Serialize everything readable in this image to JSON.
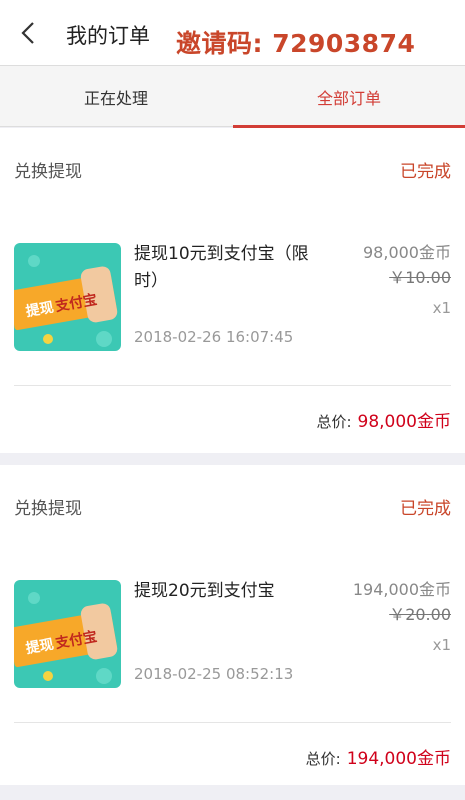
{
  "header": {
    "title": "我的订单",
    "invite": "邀请码: 72903874"
  },
  "tabs": [
    {
      "label": "正在处理"
    },
    {
      "label": "全部订单"
    }
  ],
  "orders": [
    {
      "type": "兑换提现",
      "status": "已完成",
      "thumb_text_a": "提现",
      "thumb_text_b": "支付宝",
      "name": "提现10元到支付宝（限时）",
      "date": "2018-02-26 16:07:45",
      "price": "98,000金币",
      "original": "￥10.00",
      "qty": "x1",
      "total_label": "总价:",
      "total": "98,000金币"
    },
    {
      "type": "兑换提现",
      "status": "已完成",
      "thumb_text_a": "提现",
      "thumb_text_b": "支付宝",
      "name": "提现20元到支付宝",
      "date": "2018-02-25 08:52:13",
      "price": "194,000金币",
      "original": "￥20.00",
      "qty": "x1",
      "total_label": "总价:",
      "total": "194,000金币"
    }
  ],
  "colors": {
    "accent": "#d23d36",
    "invite": "#c9462a",
    "price_red": "#d0021b",
    "thumb_bg": "#3cc8b4",
    "thumb_banner": "#f7a829"
  }
}
